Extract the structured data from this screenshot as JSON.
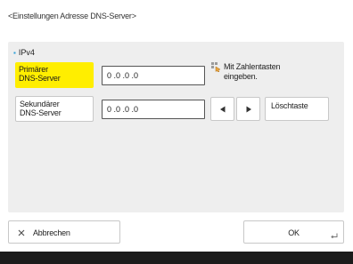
{
  "page_title": "<Einstellungen Adresse DNS-Server>",
  "section": {
    "bullet": "▪",
    "label": "IPv4"
  },
  "primary": {
    "label": "Primärer\nDNS-Server",
    "value": "0 .0 .0 .0",
    "selected": true
  },
  "secondary": {
    "label": "Sekundärer\nDNS-Server",
    "value": "0 .0 .0 .0"
  },
  "hint": {
    "icon": "numeric-keypad-hand-icon",
    "text": "Mit Zahlentasten\neingeben."
  },
  "cursor_buttons": {
    "left_icon": "arrow-left-icon",
    "right_icon": "arrow-right-icon"
  },
  "backspace_label": "Löschtaste",
  "cancel": {
    "icon": "close-x-icon",
    "label": "Abbrechen"
  },
  "ok": {
    "label": "OK",
    "icon": "enter-corner-icon"
  },
  "colors": {
    "selected_field": "#ffee00",
    "panel_background": "#eeeeee",
    "bullet": "#2a9fd8",
    "bottom_bar": "#1b1b1b"
  }
}
